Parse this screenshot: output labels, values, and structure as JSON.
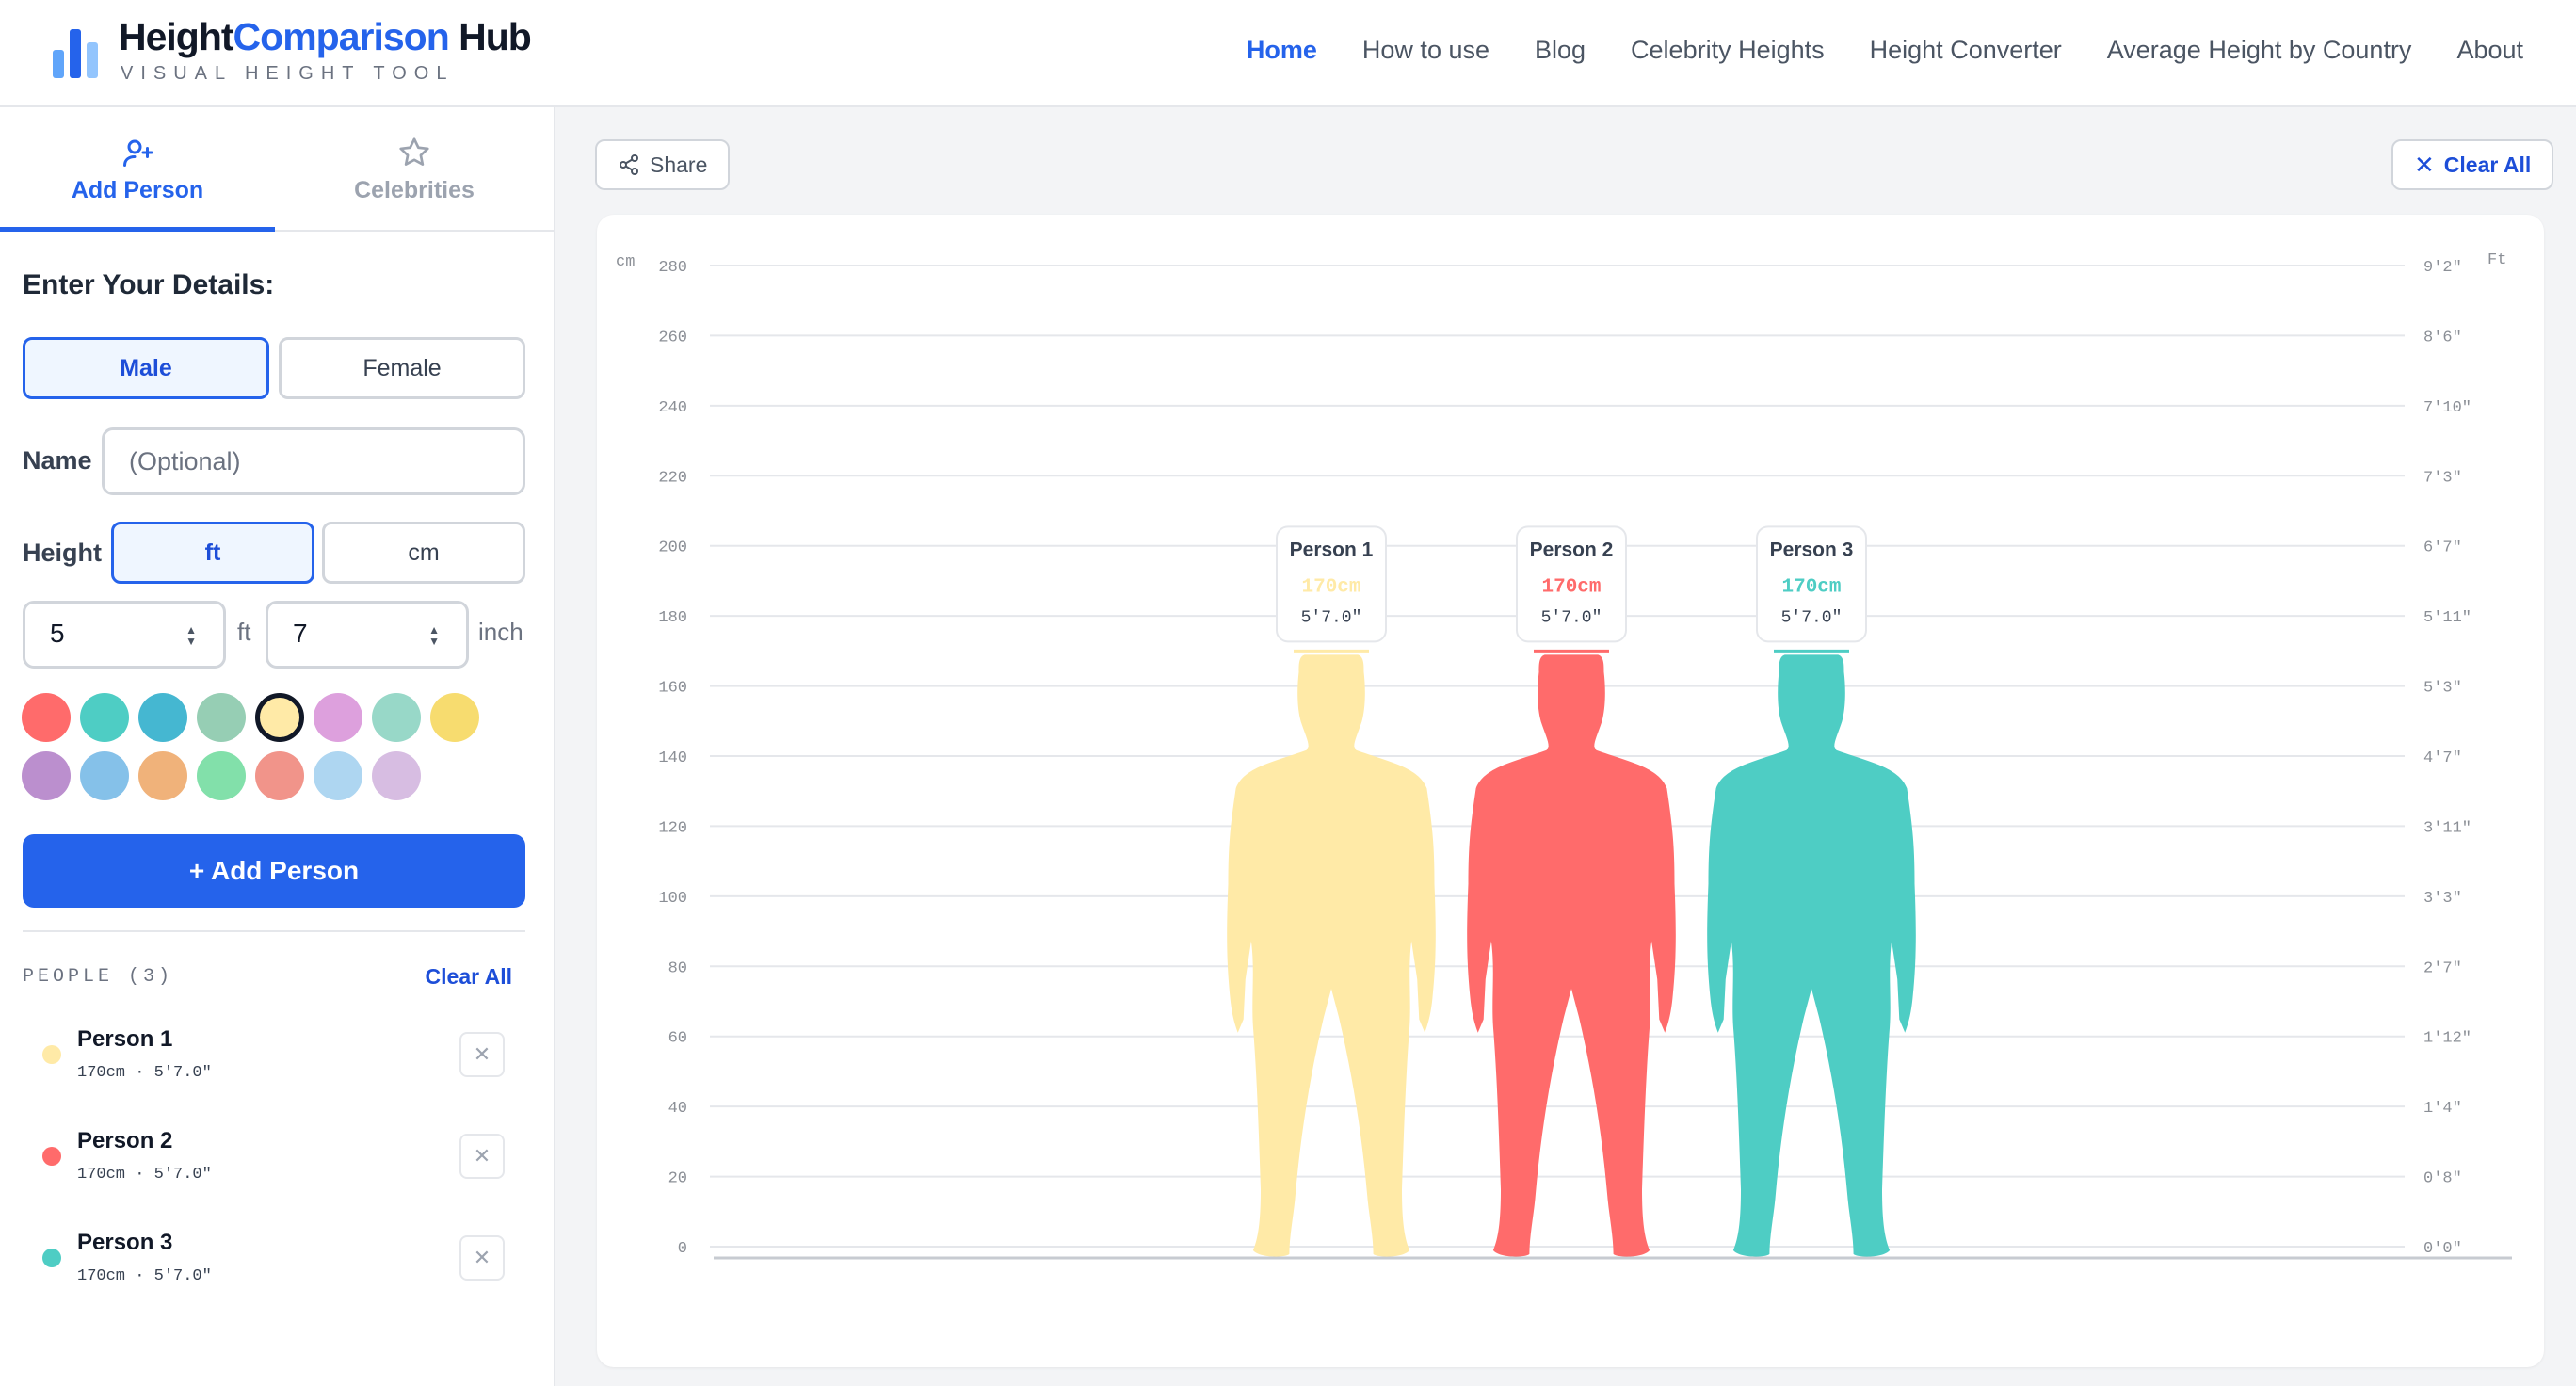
{
  "brand": {
    "title_part1": "Height",
    "title_part2": "Comparison",
    "title_part3": " Hub",
    "subtitle": "VISUAL HEIGHT TOOL"
  },
  "nav": [
    {
      "label": "Home",
      "active": true
    },
    {
      "label": "How to use",
      "active": false
    },
    {
      "label": "Blog",
      "active": false
    },
    {
      "label": "Celebrity Heights",
      "active": false
    },
    {
      "label": "Height Converter",
      "active": false
    },
    {
      "label": "Average Height by Country",
      "active": false
    },
    {
      "label": "About",
      "active": false
    }
  ],
  "tabs": [
    {
      "label": "Add Person",
      "icon": "user-plus-icon",
      "active": true
    },
    {
      "label": "Celebrities",
      "icon": "star-icon",
      "active": false
    }
  ],
  "form": {
    "title": "Enter Your Details:",
    "gender_options": [
      "Male",
      "Female"
    ],
    "gender_selected": "Male",
    "name_label": "Name",
    "name_placeholder": "(Optional)",
    "name_value": "",
    "height_label": "Height",
    "unit_options": [
      "ft",
      "cm"
    ],
    "unit_selected": "ft",
    "feet_value": "5",
    "feet_unit": "ft",
    "inch_value": "7",
    "inch_unit": "inch",
    "colors": [
      "#ff6b6b",
      "#4ecdc4",
      "#45b7d1",
      "#96ceb4",
      "#ffeaa7",
      "#dda0dd",
      "#98d8c8",
      "#f7dc6f",
      "#bb8fce",
      "#85c1e9",
      "#f0b27a",
      "#82e0aa",
      "#f1948a",
      "#aed6f1",
      "#d7bde2"
    ],
    "selected_color": "#ffeaa7",
    "add_button": "+ Add Person"
  },
  "people_section": {
    "heading": "PEOPLE (3)",
    "clear_label": "Clear All",
    "people": [
      {
        "name": "Person 1",
        "height_cm": 170,
        "cm_label": "170cm",
        "ft_label": "5'7.0\"",
        "info": "170cm · 5'7.0\"",
        "color": "#ffeaa7"
      },
      {
        "name": "Person 2",
        "height_cm": 170,
        "cm_label": "170cm",
        "ft_label": "5'7.0\"",
        "info": "170cm · 5'7.0\"",
        "color": "#ff6b6b"
      },
      {
        "name": "Person 3",
        "height_cm": 170,
        "cm_label": "170cm",
        "ft_label": "5'7.0\"",
        "info": "170cm · 5'7.0\"",
        "color": "#4ecdc4"
      }
    ]
  },
  "toolbar": {
    "share_label": "Share",
    "clear_label": "Clear All"
  },
  "chart_data": {
    "type": "height-comparison",
    "left_unit": "cm",
    "right_unit": "Ft",
    "cm_ticks": [
      280,
      260,
      240,
      220,
      200,
      180,
      160,
      140,
      120,
      100,
      80,
      60,
      40,
      20,
      0
    ],
    "ft_ticks": [
      "9'2\"",
      "8'6\"",
      "7'10\"",
      "7'3\"",
      "6'7\"",
      "5'11\"",
      "5'3\"",
      "4'7\"",
      "3'11\"",
      "3'3\"",
      "2'7\"",
      "1'12\"",
      "1'4\"",
      "0'8\"",
      "0'0\""
    ],
    "ylim": [
      0,
      280
    ],
    "bold_grid": [
      0,
      100,
      200
    ]
  }
}
